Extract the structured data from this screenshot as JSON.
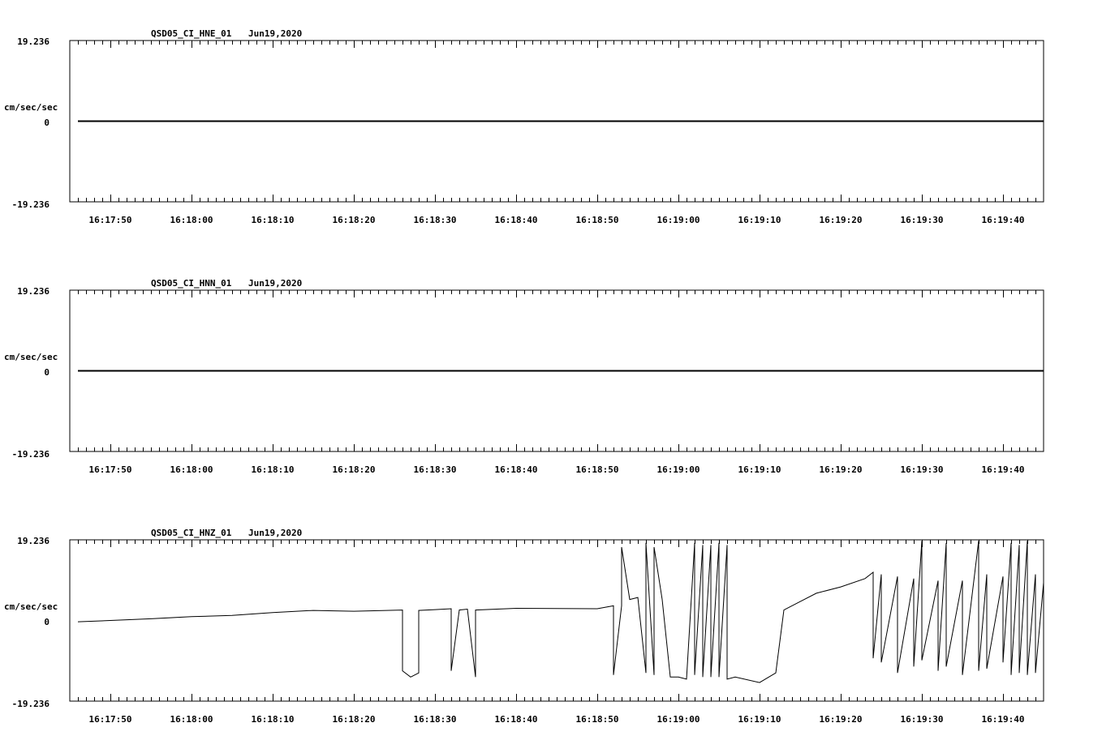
{
  "chart_data": [
    {
      "type": "line",
      "title": "QSD05_CI_HNE_01",
      "date": "Jun19,2020",
      "ylabel": "cm/sec/sec",
      "y_top_label": "19.236",
      "y_zero_label": "0",
      "y_bottom_label": "-19.236",
      "ylim": [
        -19.236,
        19.236
      ],
      "xlim": [
        "16:17:45",
        "16:19:45"
      ],
      "x_ticks": [
        "16:17:50",
        "16:18:00",
        "16:18:10",
        "16:18:20",
        "16:18:30",
        "16:18:40",
        "16:18:50",
        "16:19:00",
        "16:19:10",
        "16:19:20",
        "16:19:30",
        "16:19:40"
      ],
      "series": [
        {
          "x": [
            "16:17:46",
            "16:19:45"
          ],
          "y": [
            0,
            0
          ]
        }
      ]
    },
    {
      "type": "line",
      "title": "QSD05_CI_HNN_01",
      "date": "Jun19,2020",
      "ylabel": "cm/sec/sec",
      "y_top_label": "19.236",
      "y_zero_label": "0",
      "y_bottom_label": "-19.236",
      "ylim": [
        -19.236,
        19.236
      ],
      "xlim": [
        "16:17:45",
        "16:19:45"
      ],
      "x_ticks": [
        "16:17:50",
        "16:18:00",
        "16:18:10",
        "16:18:20",
        "16:18:30",
        "16:18:40",
        "16:18:50",
        "16:19:00",
        "16:19:10",
        "16:19:20",
        "16:19:30",
        "16:19:40"
      ],
      "series": [
        {
          "x": [
            "16:17:46",
            "16:19:45"
          ],
          "y": [
            0,
            0
          ]
        }
      ]
    },
    {
      "type": "line",
      "title": "QSD05_CI_HNZ_01",
      "date": "Jun19,2020",
      "ylabel": "cm/sec/sec",
      "y_top_label": "19.236",
      "y_zero_label": "0",
      "y_bottom_label": "-19.236",
      "ylim": [
        -19.236,
        19.236
      ],
      "xlim": [
        "16:17:45",
        "16:19:45"
      ],
      "x_ticks": [
        "16:17:50",
        "16:18:00",
        "16:18:10",
        "16:18:20",
        "16:18:30",
        "16:18:40",
        "16:18:50",
        "16:19:00",
        "16:19:10",
        "16:19:20",
        "16:19:30",
        "16:19:40"
      ],
      "series": [
        {
          "x": [
            "16:17:46",
            "16:17:50",
            "16:17:55",
            "16:18:00",
            "16:18:05",
            "16:18:10",
            "16:18:15",
            "16:18:20",
            "16:18:26",
            "16:18:26",
            "16:18:27",
            "16:18:28",
            "16:18:28",
            "16:18:30",
            "16:18:32",
            "16:18:32",
            "16:18:33",
            "16:18:34",
            "16:18:35",
            "16:18:35",
            "16:18:40",
            "16:18:50",
            "16:18:52",
            "16:18:52",
            "16:18:53",
            "16:18:53",
            "16:18:54",
            "16:18:55",
            "16:18:56",
            "16:18:56",
            "16:18:57",
            "16:18:57",
            "16:18:58",
            "16:18:59",
            "16:19:00",
            "16:19:01",
            "16:19:02",
            "16:19:02",
            "16:19:03",
            "16:19:03",
            "16:19:04",
            "16:19:04",
            "16:19:05",
            "16:19:05",
            "16:19:06",
            "16:19:06",
            "16:19:07",
            "16:19:10",
            "16:19:12",
            "16:19:13",
            "16:19:15",
            "16:19:17",
            "16:19:20",
            "16:19:23",
            "16:19:24",
            "16:19:24",
            "16:19:25",
            "16:19:25",
            "16:19:27",
            "16:19:27",
            "16:19:29",
            "16:19:29",
            "16:19:30",
            "16:19:30",
            "16:19:32",
            "16:19:32",
            "16:19:33",
            "16:19:33",
            "16:19:35",
            "16:19:35",
            "16:19:37",
            "16:19:37",
            "16:19:38",
            "16:19:38",
            "16:19:40",
            "16:19:40",
            "16:19:41",
            "16:19:41",
            "16:19:42",
            "16:19:42",
            "16:19:43",
            "16:19:43",
            "16:19:44",
            "16:19:44",
            "16:19:45"
          ],
          "y": [
            -0.3,
            0.0,
            0.4,
            0.9,
            1.2,
            1.9,
            2.4,
            2.2,
            2.5,
            -12.0,
            -13.5,
            -12.5,
            2.4,
            2.6,
            2.8,
            -12.0,
            2.5,
            2.7,
            -13.5,
            2.5,
            2.9,
            2.8,
            3.5,
            -13.0,
            3.5,
            17.5,
            5.0,
            5.5,
            -12.5,
            18.5,
            -13.0,
            17.5,
            5.0,
            -13.5,
            -13.5,
            -14.0,
            18.5,
            -13.0,
            18.0,
            -13.5,
            18.0,
            -13.5,
            18.5,
            -13.5,
            18.0,
            -14.0,
            -13.5,
            -14.8,
            -12.5,
            2.5,
            4.5,
            6.5,
            8.0,
            10.0,
            11.5,
            -9.0,
            11.0,
            -10.0,
            10.5,
            -12.5,
            10.0,
            -11.0,
            19.0,
            -9.5,
            9.5,
            -12.0,
            18.5,
            -11.0,
            9.5,
            -13.0,
            19.0,
            -12.0,
            11.0,
            -11.5,
            10.5,
            -10.0,
            18.5,
            -13.0,
            18.0,
            -12.5,
            19.0,
            -13.0,
            11.0,
            -12.5,
            9.0
          ]
        }
      ]
    }
  ]
}
